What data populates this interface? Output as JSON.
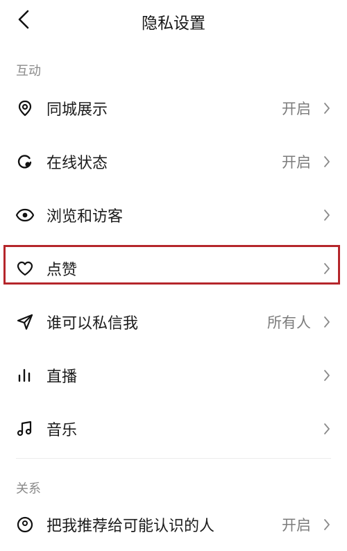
{
  "header": {
    "title": "隐私设置"
  },
  "sections": {
    "interaction": {
      "label": "互动"
    },
    "relationship": {
      "label": "关系"
    }
  },
  "rows": {
    "local_display": {
      "label": "同城展示",
      "value": "开启",
      "icon": "location-pin-icon"
    },
    "online_status": {
      "label": "在线状态",
      "value": "开启",
      "icon": "online-status-icon"
    },
    "browsing_visitors": {
      "label": "浏览和访客",
      "value": "",
      "icon": "eye-icon"
    },
    "likes": {
      "label": "点赞",
      "value": "",
      "icon": "heart-icon"
    },
    "who_can_message": {
      "label": "谁可以私信我",
      "value": "所有人",
      "icon": "send-icon"
    },
    "live": {
      "label": "直播",
      "value": "",
      "icon": "live-bars-icon"
    },
    "music": {
      "label": "音乐",
      "value": "",
      "icon": "music-note-icon"
    },
    "recommend": {
      "label": "把我推荐给可能认识的人",
      "value": "开启",
      "icon": "contacts-icon"
    }
  },
  "colors": {
    "highlight_border": "#b5262b",
    "secondary_text": "#7c7c7c",
    "section_text": "#8a8a8a"
  }
}
